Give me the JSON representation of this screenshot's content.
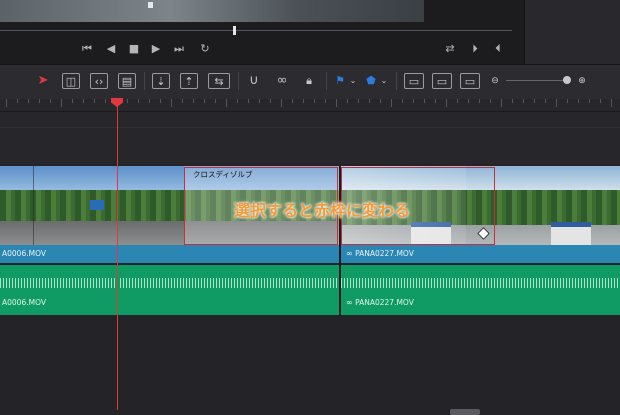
{
  "toolbar": {
    "colors": {
      "select_tool": "#e0383f",
      "flag": "#2d7be0",
      "marker": "#2d7be0",
      "playhead": "#e0383f",
      "video_clip": "#2c86b4",
      "audio_clip": "#0f9b63",
      "selection": "#c0333a",
      "annotation": "#f39a3a"
    },
    "tools": [
      "arrow-select-icon",
      "trim-icon",
      "dynamic-trim-icon",
      "blade-icon",
      "insert-icon",
      "overwrite-icon",
      "replace-icon",
      "snap-icon",
      "link-icon",
      "lock-icon",
      "flag-icon",
      "marker-icon",
      "zoom-full-icon",
      "zoom-detail-icon",
      "zoom-custom-icon",
      "zoom-out-icon",
      "zoom-in-icon"
    ]
  },
  "transport": {
    "icons": [
      "go-to-start-icon",
      "play-reverse-icon",
      "stop-icon",
      "play-icon",
      "go-to-end-icon",
      "loop-icon",
      "match-frame-icon",
      "next-edit-icon",
      "prev-edit-icon"
    ]
  },
  "timeline": {
    "title_clip": {
      "label": "クロスディゾルブ"
    },
    "video_clips": [
      {
        "name": "A0006.MOV"
      },
      {
        "name": "PANA0227.MOV"
      }
    ],
    "audio_clips": [
      {
        "name": "A0006.MOV"
      },
      {
        "name": "PANA0227.MOV"
      }
    ]
  },
  "annotation": {
    "text": "選択すると赤枠に変わる"
  }
}
